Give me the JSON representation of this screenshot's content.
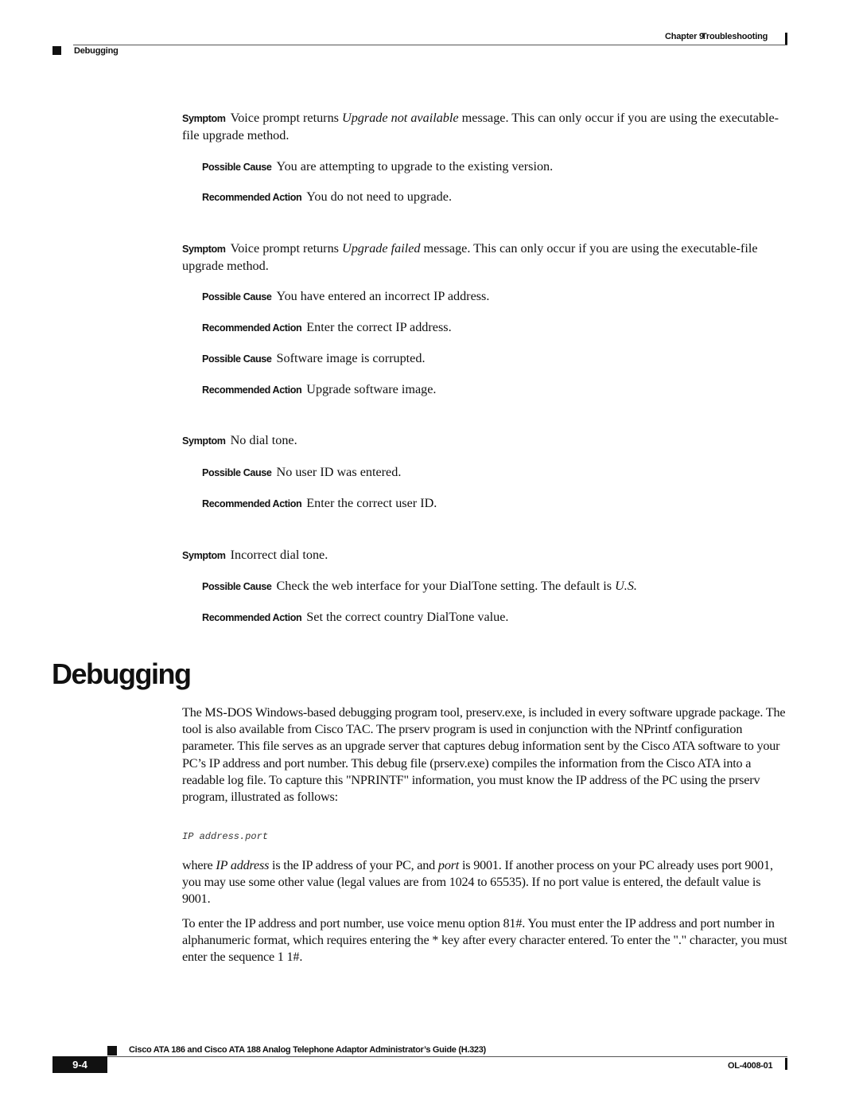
{
  "header": {
    "chapter": "Chapter 9",
    "chapter_title": "Troubleshooting",
    "section": "Debugging"
  },
  "troubleshooting": [
    {
      "symptom_label": "Symptom",
      "symptom_pre": "Voice prompt returns ",
      "symptom_italic": "Upgrade not available",
      "symptom_post": " message. This can only occur if you are using the executable-file upgrade method.",
      "items": [
        {
          "label": "Possible Cause",
          "text": "You are attempting to upgrade to the existing version."
        },
        {
          "label": "Recommended Action",
          "text": "You do not need to upgrade."
        }
      ]
    },
    {
      "symptom_label": "Symptom",
      "symptom_pre": "Voice prompt returns ",
      "symptom_italic": "Upgrade failed",
      "symptom_post": " message. This can only occur if you are using the executable-file upgrade method.",
      "items": [
        {
          "label": "Possible Cause",
          "text": "You have entered an incorrect IP address."
        },
        {
          "label": "Recommended Action",
          "text": "Enter the correct IP address."
        },
        {
          "label": "Possible Cause",
          "text": "Software image is corrupted."
        },
        {
          "label": "Recommended Action",
          "text": "Upgrade software image."
        }
      ]
    },
    {
      "symptom_label": "Symptom",
      "symptom_pre": "No dial tone.",
      "symptom_italic": "",
      "symptom_post": "",
      "items": [
        {
          "label": "Possible Cause",
          "text": "No user ID was entered."
        },
        {
          "label": "Recommended Action",
          "text": "Enter the correct user ID."
        }
      ]
    },
    {
      "symptom_label": "Symptom",
      "symptom_pre": "Incorrect dial tone.",
      "symptom_italic": "",
      "symptom_post": "",
      "items": [
        {
          "label": "Possible Cause",
          "text": "Check the web interface for your DialTone setting. The default is ",
          "italic": "U.S."
        },
        {
          "label": "Recommended Action",
          "text": "Set the correct country DialTone value."
        }
      ]
    }
  ],
  "debugging": {
    "title": "Debugging",
    "intro": "The MS-DOS Windows-based debugging program tool, preserv.exe, is included in every software upgrade package. The tool is also available from Cisco TAC. The prserv program is used in conjunction with the NPrintf configuration parameter. This file serves as an upgrade server that captures debug information sent by the Cisco ATA software to your PC’s IP address and port number. This debug file (prserv.exe) compiles the information from the Cisco ATA into a readable log file. To capture this \"NPRINTF\" information, you must know the IP address of the PC using the prserv program, illustrated as follows:",
    "code": "IP address.port",
    "where_1": "where ",
    "where_ip": "IP address",
    "where_2": " is the IP address of your PC, and ",
    "where_port": "port",
    "where_3": " is 9001. If another process on your PC already uses port 9001, you may use some other value (legal values are from 1024 to 65535). If no port value is entered, the default value is 9001.",
    "enter_para": "To enter the IP address and port number, use voice menu option 81#.  You must enter the IP address and port number in alphanumeric format, which requires entering the * key after every character entered. To enter the \".\" character, you must enter the sequence 1 1#."
  },
  "footer": {
    "guide_title": "Cisco ATA 186 and Cisco ATA 188 Analog Telephone Adaptor Administrator’s Guide (H.323)",
    "page_number": "9-4",
    "doc_id": "OL-4008-01"
  }
}
